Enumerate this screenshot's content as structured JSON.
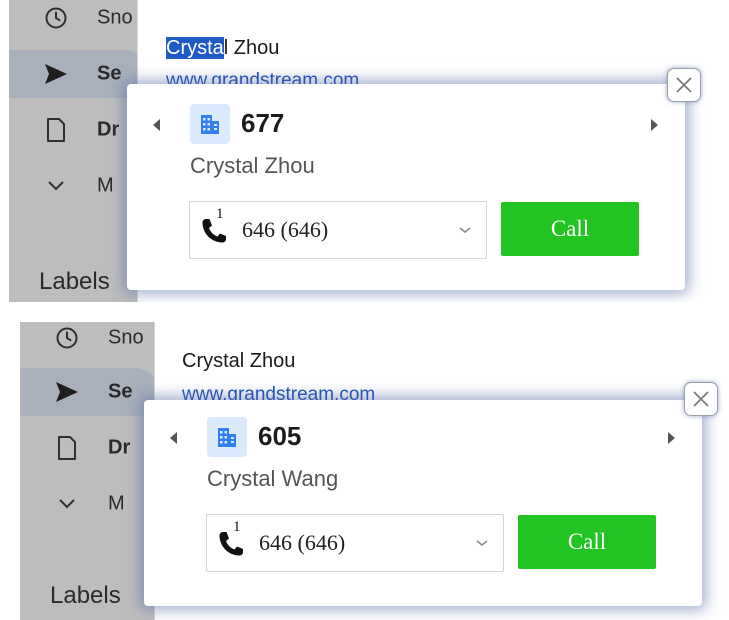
{
  "panels": [
    {
      "nav": [
        {
          "label": "Sno",
          "icon": "clock-icon",
          "bold": false,
          "active": false
        },
        {
          "label": "Se",
          "icon": "send-icon",
          "bold": true,
          "active": true
        },
        {
          "label": "Dr",
          "icon": "draft-icon",
          "bold": true,
          "active": false
        },
        {
          "label": "M",
          "icon": "chevron-down-icon",
          "bold": false,
          "active": false
        }
      ],
      "labels_heading": "Labels",
      "email": {
        "name_selected": "Crysta",
        "name_rest": "l Zhou",
        "link": "www.grandstream.com"
      },
      "popup": {
        "extension": "677",
        "name": "Crystal Zhou",
        "number_line": "1",
        "number": "646 (646)",
        "call_label": "Call"
      }
    },
    {
      "nav": [
        {
          "label": "Sno",
          "icon": "clock-icon",
          "bold": false,
          "active": false
        },
        {
          "label": "Se",
          "icon": "send-icon",
          "bold": true,
          "active": true
        },
        {
          "label": "Dr",
          "icon": "draft-icon",
          "bold": true,
          "active": false
        },
        {
          "label": "M",
          "icon": "chevron-down-icon",
          "bold": false,
          "active": false
        }
      ],
      "labels_heading": "Labels",
      "email": {
        "name_selected": "",
        "name_rest": "Crystal Zhou",
        "link": "www.grandstream.com"
      },
      "popup": {
        "extension": "605",
        "name": "Crystal Wang",
        "number_line": "1",
        "number": "646 (646)",
        "call_label": "Call"
      }
    }
  ],
  "colors": {
    "call_button": "#22c422",
    "selection": "#1e5bc6",
    "link": "#1a4fb8",
    "building_icon": "#2f7ff0"
  }
}
